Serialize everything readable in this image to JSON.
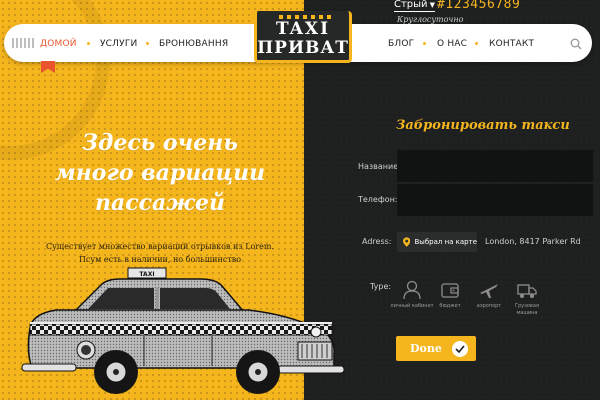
{
  "contacts": {
    "city": "Стрый",
    "phone": "#123456789",
    "hours": "Круглосуточно"
  },
  "nav": {
    "items": [
      "ДОМОЙ",
      "УСЛУГИ",
      "БРОНЮВАННЯ",
      "БЛОГ",
      "О НАС",
      "КОНТАКТ"
    ],
    "active_index": 0
  },
  "logo": {
    "top": "TAXI",
    "bottom": "ПРИВАТ"
  },
  "hero": {
    "title_lines": [
      "Здесь очень",
      "много вариации",
      "пассажей"
    ],
    "description_lines": [
      "Существует множество вариаций отрывков из Lorem.",
      "Псум есть в наличии, но большинство"
    ]
  },
  "taxi_sign": "TAXI",
  "booking_form": {
    "title": "Забронировать такси",
    "name_label": "Название:",
    "name_value": "",
    "phone_label": "Телефон:",
    "phone_value": "",
    "address_label": "Adress:",
    "map_button_label": "Выбрал на карте",
    "address_value": "London, 8417 Parker Rd",
    "type_label": "Type:",
    "types": [
      {
        "label": "личный кабинет",
        "icon": "person-icon"
      },
      {
        "label": "бюджет",
        "icon": "wallet-icon"
      },
      {
        "label": "аэропорт",
        "icon": "airplane-icon"
      },
      {
        "label": "Грузовая машина",
        "icon": "truck-icon"
      }
    ],
    "submit_label": "Done"
  },
  "colors": {
    "accent_yellow": "#f5b51d",
    "dark_bg": "#1e1f1f",
    "active_nav": "#e9552e"
  }
}
